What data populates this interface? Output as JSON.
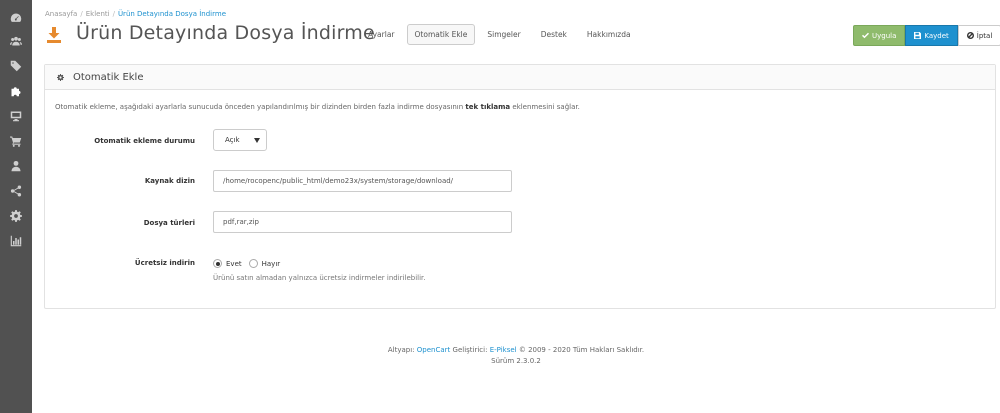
{
  "sidebar": {
    "items": [
      {
        "icon": "dashboard-icon"
      },
      {
        "icon": "users-icon"
      },
      {
        "icon": "tags-icon"
      },
      {
        "icon": "puzzle-icon",
        "active": true
      },
      {
        "icon": "desktop-icon"
      },
      {
        "icon": "cart-icon"
      },
      {
        "icon": "user-icon"
      },
      {
        "icon": "share-icon"
      },
      {
        "icon": "cog-icon"
      },
      {
        "icon": "bar-chart-icon"
      }
    ]
  },
  "breadcrumb": {
    "home": "Anasayfa",
    "separator": "/",
    "extensions": "Eklenti",
    "current": "Ürün Detayında Dosya İndirme"
  },
  "header": {
    "title": "Ürün Detayında Dosya İndirme",
    "tabs": [
      "Ayarlar",
      "Otomatik Ekle",
      "Simgeler",
      "Destek",
      "Hakkımızda"
    ],
    "active_tab": "Otomatik Ekle"
  },
  "actions": {
    "apply": "Uygula",
    "save": "Kaydet",
    "cancel": "İptal"
  },
  "panel": {
    "title": "Otomatik Ekle",
    "intro_before": "Otomatik ekleme, aşağıdaki ayarlarla sunucuda önceden yapılandırılmış bir dizinden birden fazla indirme dosyasının ",
    "intro_bold": "tek tıklama",
    "intro_after": " eklenmesini sağlar."
  },
  "form": {
    "status_label": "Otomatik ekleme durumu",
    "status_value": "Açık",
    "source_label": "Kaynak dizin",
    "source_value": "/home/rocopenc/public_html/demo23x/system/storage/download/",
    "types_label": "Dosya türleri",
    "types_value": "pdf,rar,zip",
    "free_label": "Ücretsiz indirin",
    "free_yes": "Evet",
    "free_no": "Hayır",
    "free_selected": "Evet",
    "free_help": "Ürünü satın almadan yalnızca ücretsiz indirmeler indirilebilir."
  },
  "footer": {
    "powered_prefix": "Altyapı:",
    "opencart": "OpenCart",
    "developer_prefix": "Geliştirici:",
    "developer": "E-Piksel",
    "copyright": "© 2009 - 2020 Tüm Hakları Saklıdır.",
    "version": "Sürüm 2.3.0.2"
  },
  "colors": {
    "sidebar": "#515151",
    "accent": "#1e91cf",
    "apply": "#8fbb6c",
    "page_icon": "#e68a2e"
  }
}
